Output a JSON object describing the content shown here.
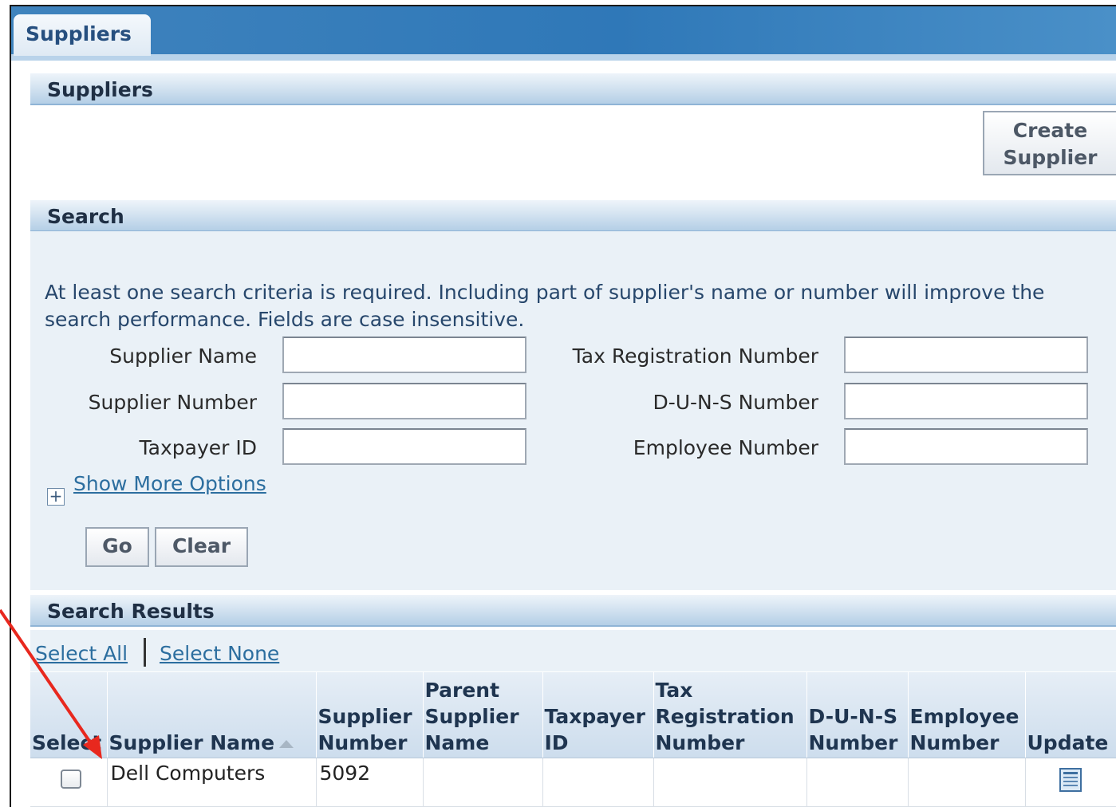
{
  "tab": {
    "label": "Suppliers"
  },
  "suppliers_section": {
    "title": "Suppliers",
    "create_button": "Create Supplier"
  },
  "search": {
    "title": "Search",
    "help_text": "At least one search criteria is required. Including part of supplier's name or number will improve the search performance. Fields are case insensitive.",
    "fields": {
      "supplier_name": {
        "label": "Supplier Name",
        "value": ""
      },
      "supplier_number": {
        "label": "Supplier Number",
        "value": ""
      },
      "taxpayer_id": {
        "label": "Taxpayer ID",
        "value": ""
      },
      "tax_registration_number": {
        "label": "Tax Registration Number",
        "value": ""
      },
      "duns_number": {
        "label": "D-U-N-S Number",
        "value": ""
      },
      "employee_number": {
        "label": "Employee Number",
        "value": ""
      }
    },
    "show_more": "Show More Options",
    "go_button": "Go",
    "clear_button": "Clear"
  },
  "results": {
    "title": "Search Results",
    "select_all": "Select All",
    "select_none": "Select None",
    "columns": [
      "Select",
      "Supplier Name",
      "Supplier Number",
      "Parent Supplier Name",
      "Taxpayer ID",
      "Tax Registration Number",
      "D-U-N-S Number",
      "Employee Number",
      "Update"
    ],
    "rows": [
      {
        "supplier_name": "Dell Computers",
        "supplier_number": "5092",
        "parent_supplier_name": "",
        "taxpayer_id": "",
        "tax_registration_number": "",
        "duns_number": "",
        "employee_number": ""
      }
    ]
  },
  "colors": {
    "tab_bar": "#2f78b8",
    "panel_bg": "#eaf1f7",
    "link": "#2c6e9f",
    "annotation_arrow": "#e8281e"
  },
  "icons": [
    "expand-plus-icon",
    "sort-ascending-icon",
    "update-icon",
    "annotation-arrow"
  ]
}
